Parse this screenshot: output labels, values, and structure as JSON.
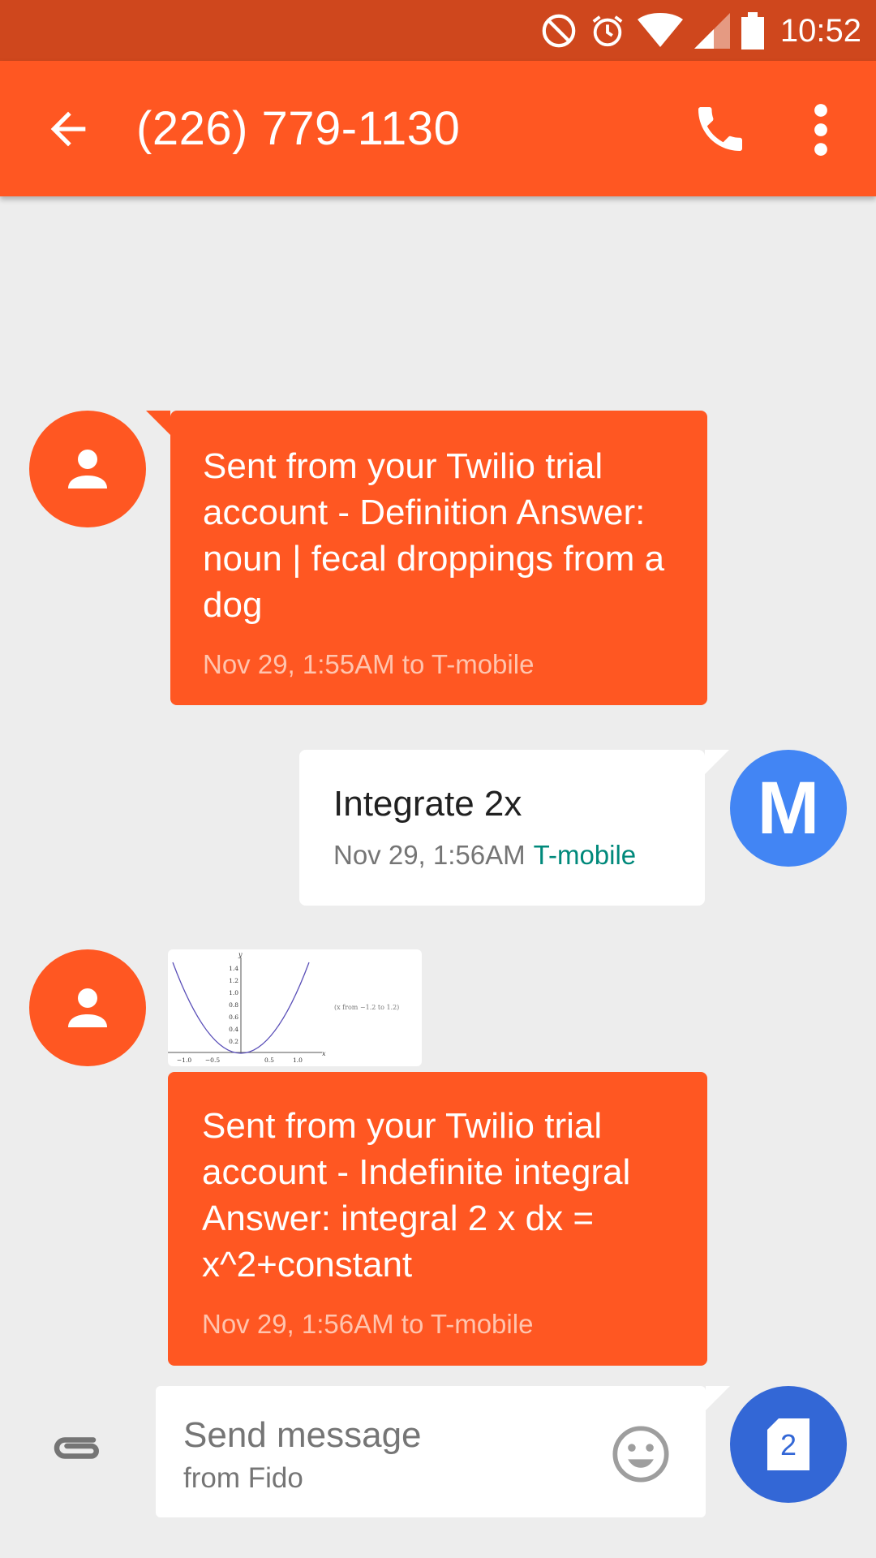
{
  "status_bar": {
    "time": "10:52",
    "icons": [
      "do-not-disturb-icon",
      "alarm-icon",
      "wifi-icon",
      "cell-signal-icon",
      "battery-icon"
    ]
  },
  "app_bar": {
    "title": "(226) 779-1130",
    "background": "#ff5722",
    "actions": [
      "back-arrow-icon",
      "phone-icon",
      "more-vert-icon"
    ]
  },
  "messages": [
    {
      "direction": "incoming",
      "text": "Sent from your Twilio trial account - Definition Answer: noun | fecal droppings from a dog",
      "timestamp": "Nov 29, 1:55AM",
      "route": "to T-mobile"
    },
    {
      "direction": "outgoing",
      "sender_initial": "M",
      "text": "Integrate 2x",
      "timestamp": "Nov 29, 1:56AM",
      "carrier": "T-mobile"
    },
    {
      "direction": "incoming",
      "attachment": {
        "y_axis_label": "y",
        "x_axis_label": "x",
        "y_ticks": [
          "1.4",
          "1.2",
          "1.0",
          "0.8",
          "0.6",
          "0.4",
          "0.2"
        ],
        "x_ticks": [
          "−1.0",
          "−0.5",
          "0.5",
          "1.0"
        ],
        "note": "(x from −1.2 to 1.2)"
      },
      "text": "Sent from your Twilio trial account - Indefinite integral Answer:  integral 2 x dx = x^2+constant",
      "timestamp": "Nov 29, 1:56AM",
      "route": "to T-mobile"
    }
  ],
  "composer": {
    "placeholder": "Send message",
    "subtitle": "from Fido",
    "sim_number": "2"
  },
  "colors": {
    "status_bar": "#cf471d",
    "incoming_bubble": "#ff5722",
    "outgoing_avatar": "#4285f4",
    "send_button": "#3367d6",
    "carrier_text": "#00897b"
  }
}
